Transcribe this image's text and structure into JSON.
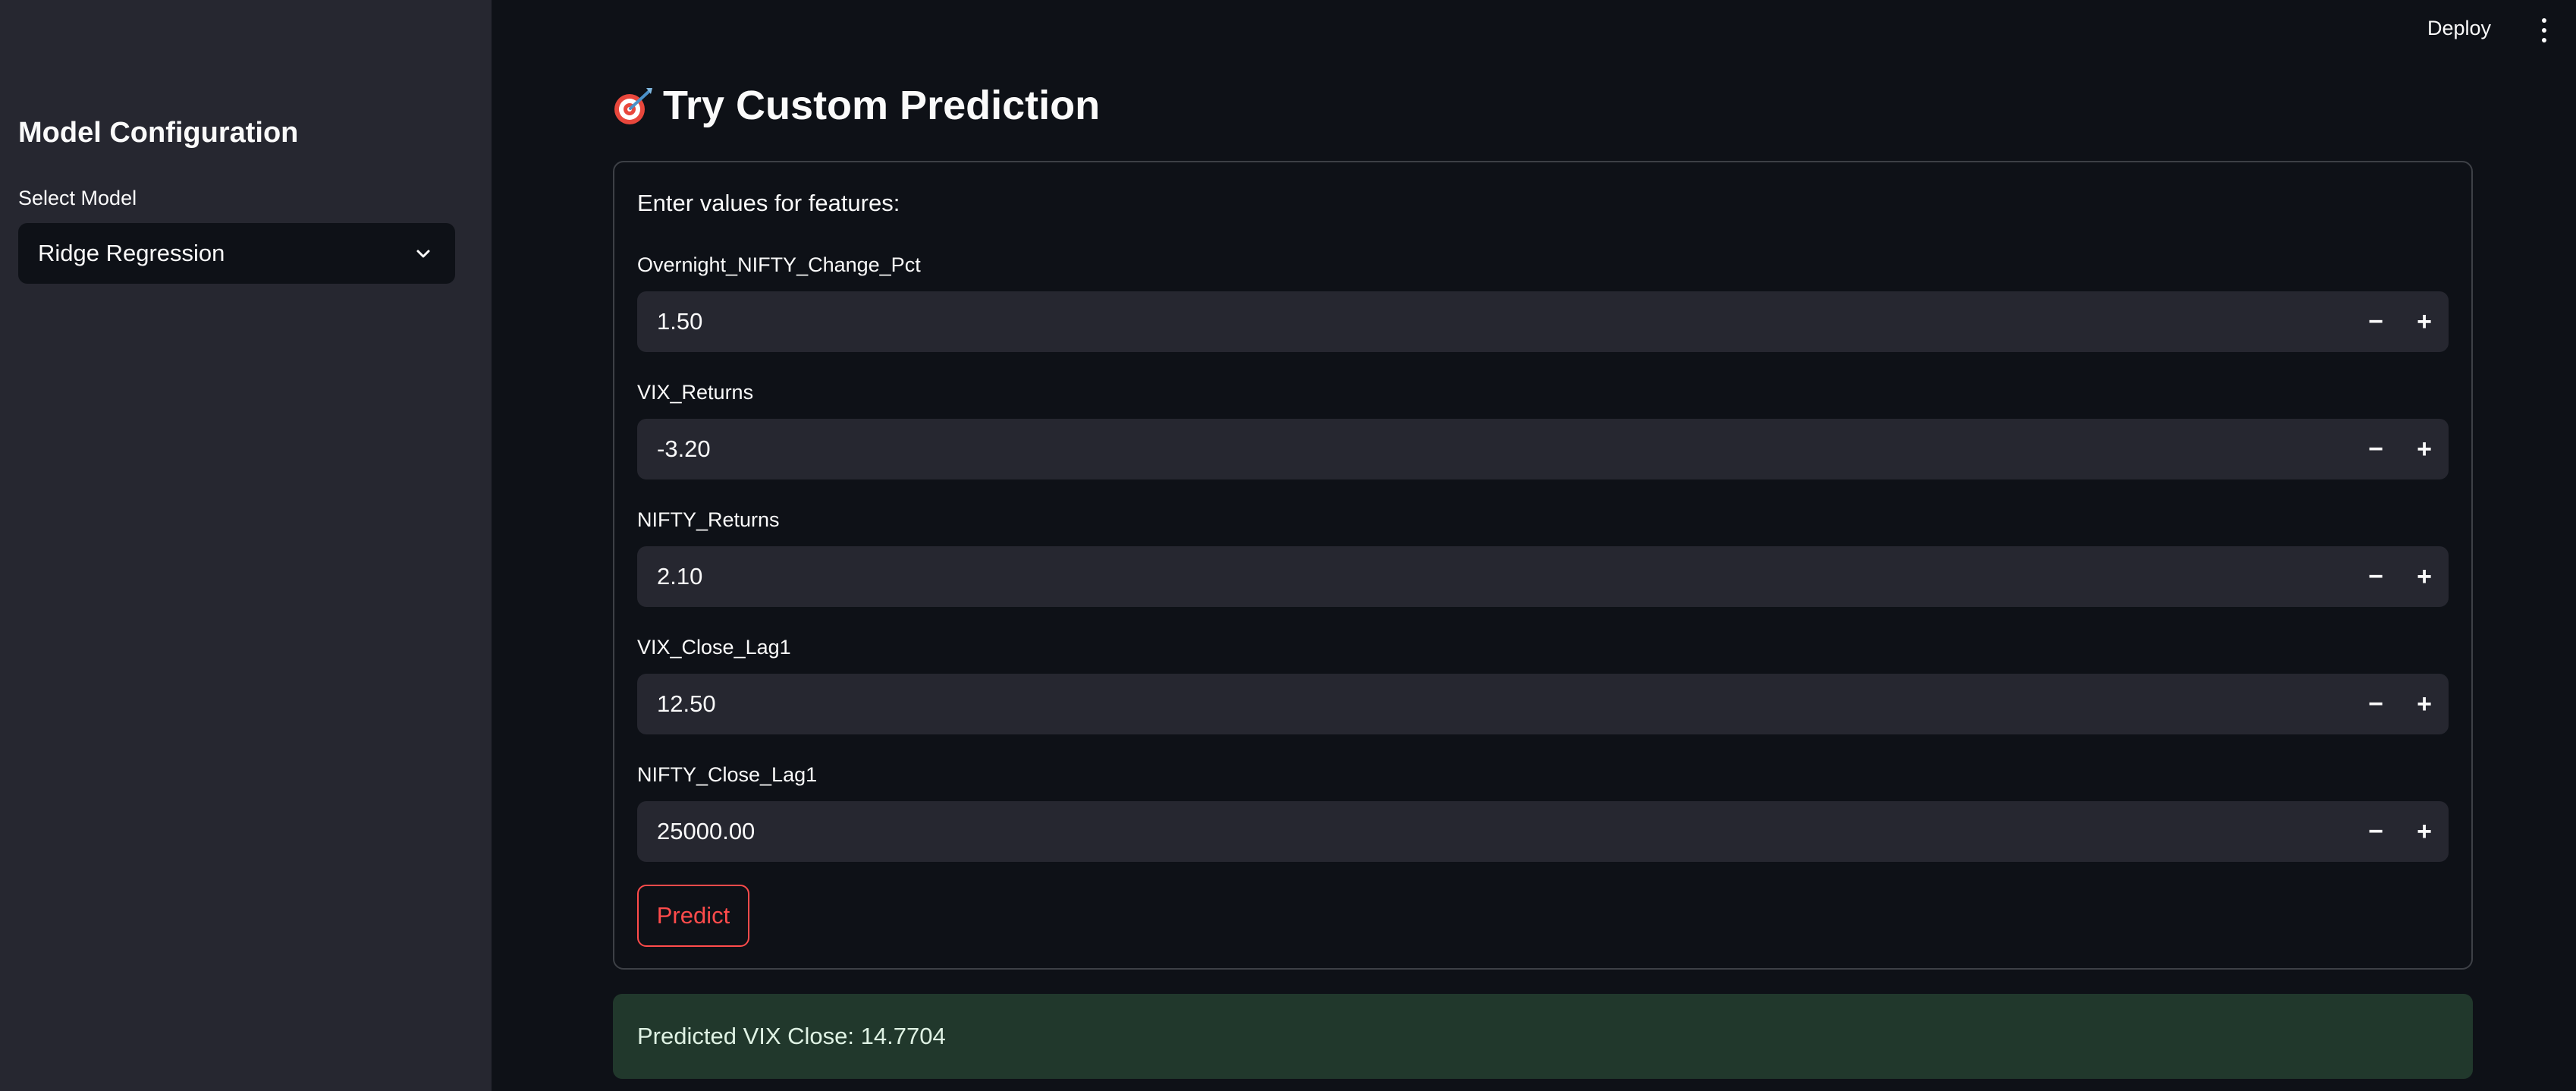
{
  "header": {
    "deploy_label": "Deploy",
    "menu_icon": "kebab-menu-icon"
  },
  "sidebar": {
    "title": "Model Configuration",
    "select_label": "Select Model",
    "selected_model": "Ridge Regression",
    "dropdown_icon": "chevron-down-icon"
  },
  "main": {
    "heading": "Try Custom Prediction",
    "heading_icon": "dart-target-icon",
    "form_intro": "Enter values for features:",
    "fields": [
      {
        "label": "Overnight_NIFTY_Change_Pct",
        "value": "1.50"
      },
      {
        "label": "VIX_Returns",
        "value": "-3.20"
      },
      {
        "label": "NIFTY_Returns",
        "value": "2.10"
      },
      {
        "label": "VIX_Close_Lag1",
        "value": "12.50"
      },
      {
        "label": "NIFTY_Close_Lag1",
        "value": "25000.00"
      }
    ],
    "step_minus": "−",
    "step_plus": "+",
    "predict_label": "Predict",
    "result": "Predicted VIX Close: 14.7704"
  },
  "colors": {
    "background": "#0e1117",
    "sidebar": "#262730",
    "input_bg": "#262730",
    "accent": "#ff4b4b",
    "success_bg": "#21382c"
  }
}
